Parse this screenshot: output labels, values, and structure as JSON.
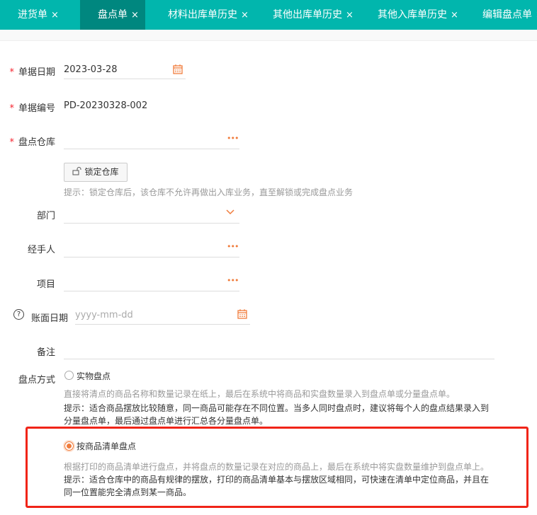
{
  "tabs": [
    {
      "label": "进货单",
      "close": "×"
    },
    {
      "label": "盘点单",
      "close": "×",
      "active": true
    },
    {
      "label": "材料出库单历史",
      "close": "×"
    },
    {
      "label": "其他出库单历史",
      "close": "×"
    },
    {
      "label": "其他入库单历史",
      "close": "×"
    },
    {
      "label": "编辑盘点单",
      "close": "×"
    }
  ],
  "form": {
    "required_mark": "*",
    "doc_date": {
      "label": "单据日期",
      "value": "2023-03-28"
    },
    "doc_no": {
      "label": "单据编号",
      "value": "PD-20230328-002"
    },
    "warehouse": {
      "label": "盘点仓库",
      "value": "",
      "more": "•••"
    },
    "lock_button": "锁定仓库",
    "lock_hint": "提示：锁定仓库后，该仓库不允许再做出入库业务，直至解锁或完成盘点业务",
    "department": {
      "label": "部门",
      "value": ""
    },
    "handler": {
      "label": "经手人",
      "value": "",
      "more": "•••"
    },
    "project": {
      "label": "项目",
      "value": "",
      "more": "•••"
    },
    "book_date": {
      "label": "账面日期",
      "placeholder": "yyyy-mm-dd",
      "help": "?"
    },
    "remark": {
      "label": "备注",
      "value": ""
    },
    "method": {
      "label": "盘点方式",
      "options": [
        {
          "label": "实物盘点",
          "selected": false,
          "desc": "直接将清点的商品名称和数量记录在纸上，最后在系统中将商品和实盘数量录入到盘点单或分量盘点单。",
          "tip1": "提示：适合商品摆放比较随意，同一商品可能存在不同位置。当多人同时盘点时，建议将每个人的盘点结果录入到",
          "tip2": "分量盘点单，最后通过盘点单进行汇总各分量盘点单。"
        },
        {
          "label": "按商品清单盘点",
          "selected": true,
          "desc": "根据打印的商品清单进行盘点，并将盘点的数量记录在对应的商品上，最后在系统中将实盘数量维护到盘点单上。",
          "tip1": "提示：适合仓库中的商品有规律的摆放，打印的商品清单基本与摆放区域相同，可快速在清单中定位商品，并且在",
          "tip2": "同一位置能完全清点到某一商品。"
        }
      ]
    }
  },
  "colors": {
    "tab_bg": "#01b6ad",
    "tab_active": "#00877f",
    "accent": "#f07c3c",
    "highlight": "#f02418"
  }
}
